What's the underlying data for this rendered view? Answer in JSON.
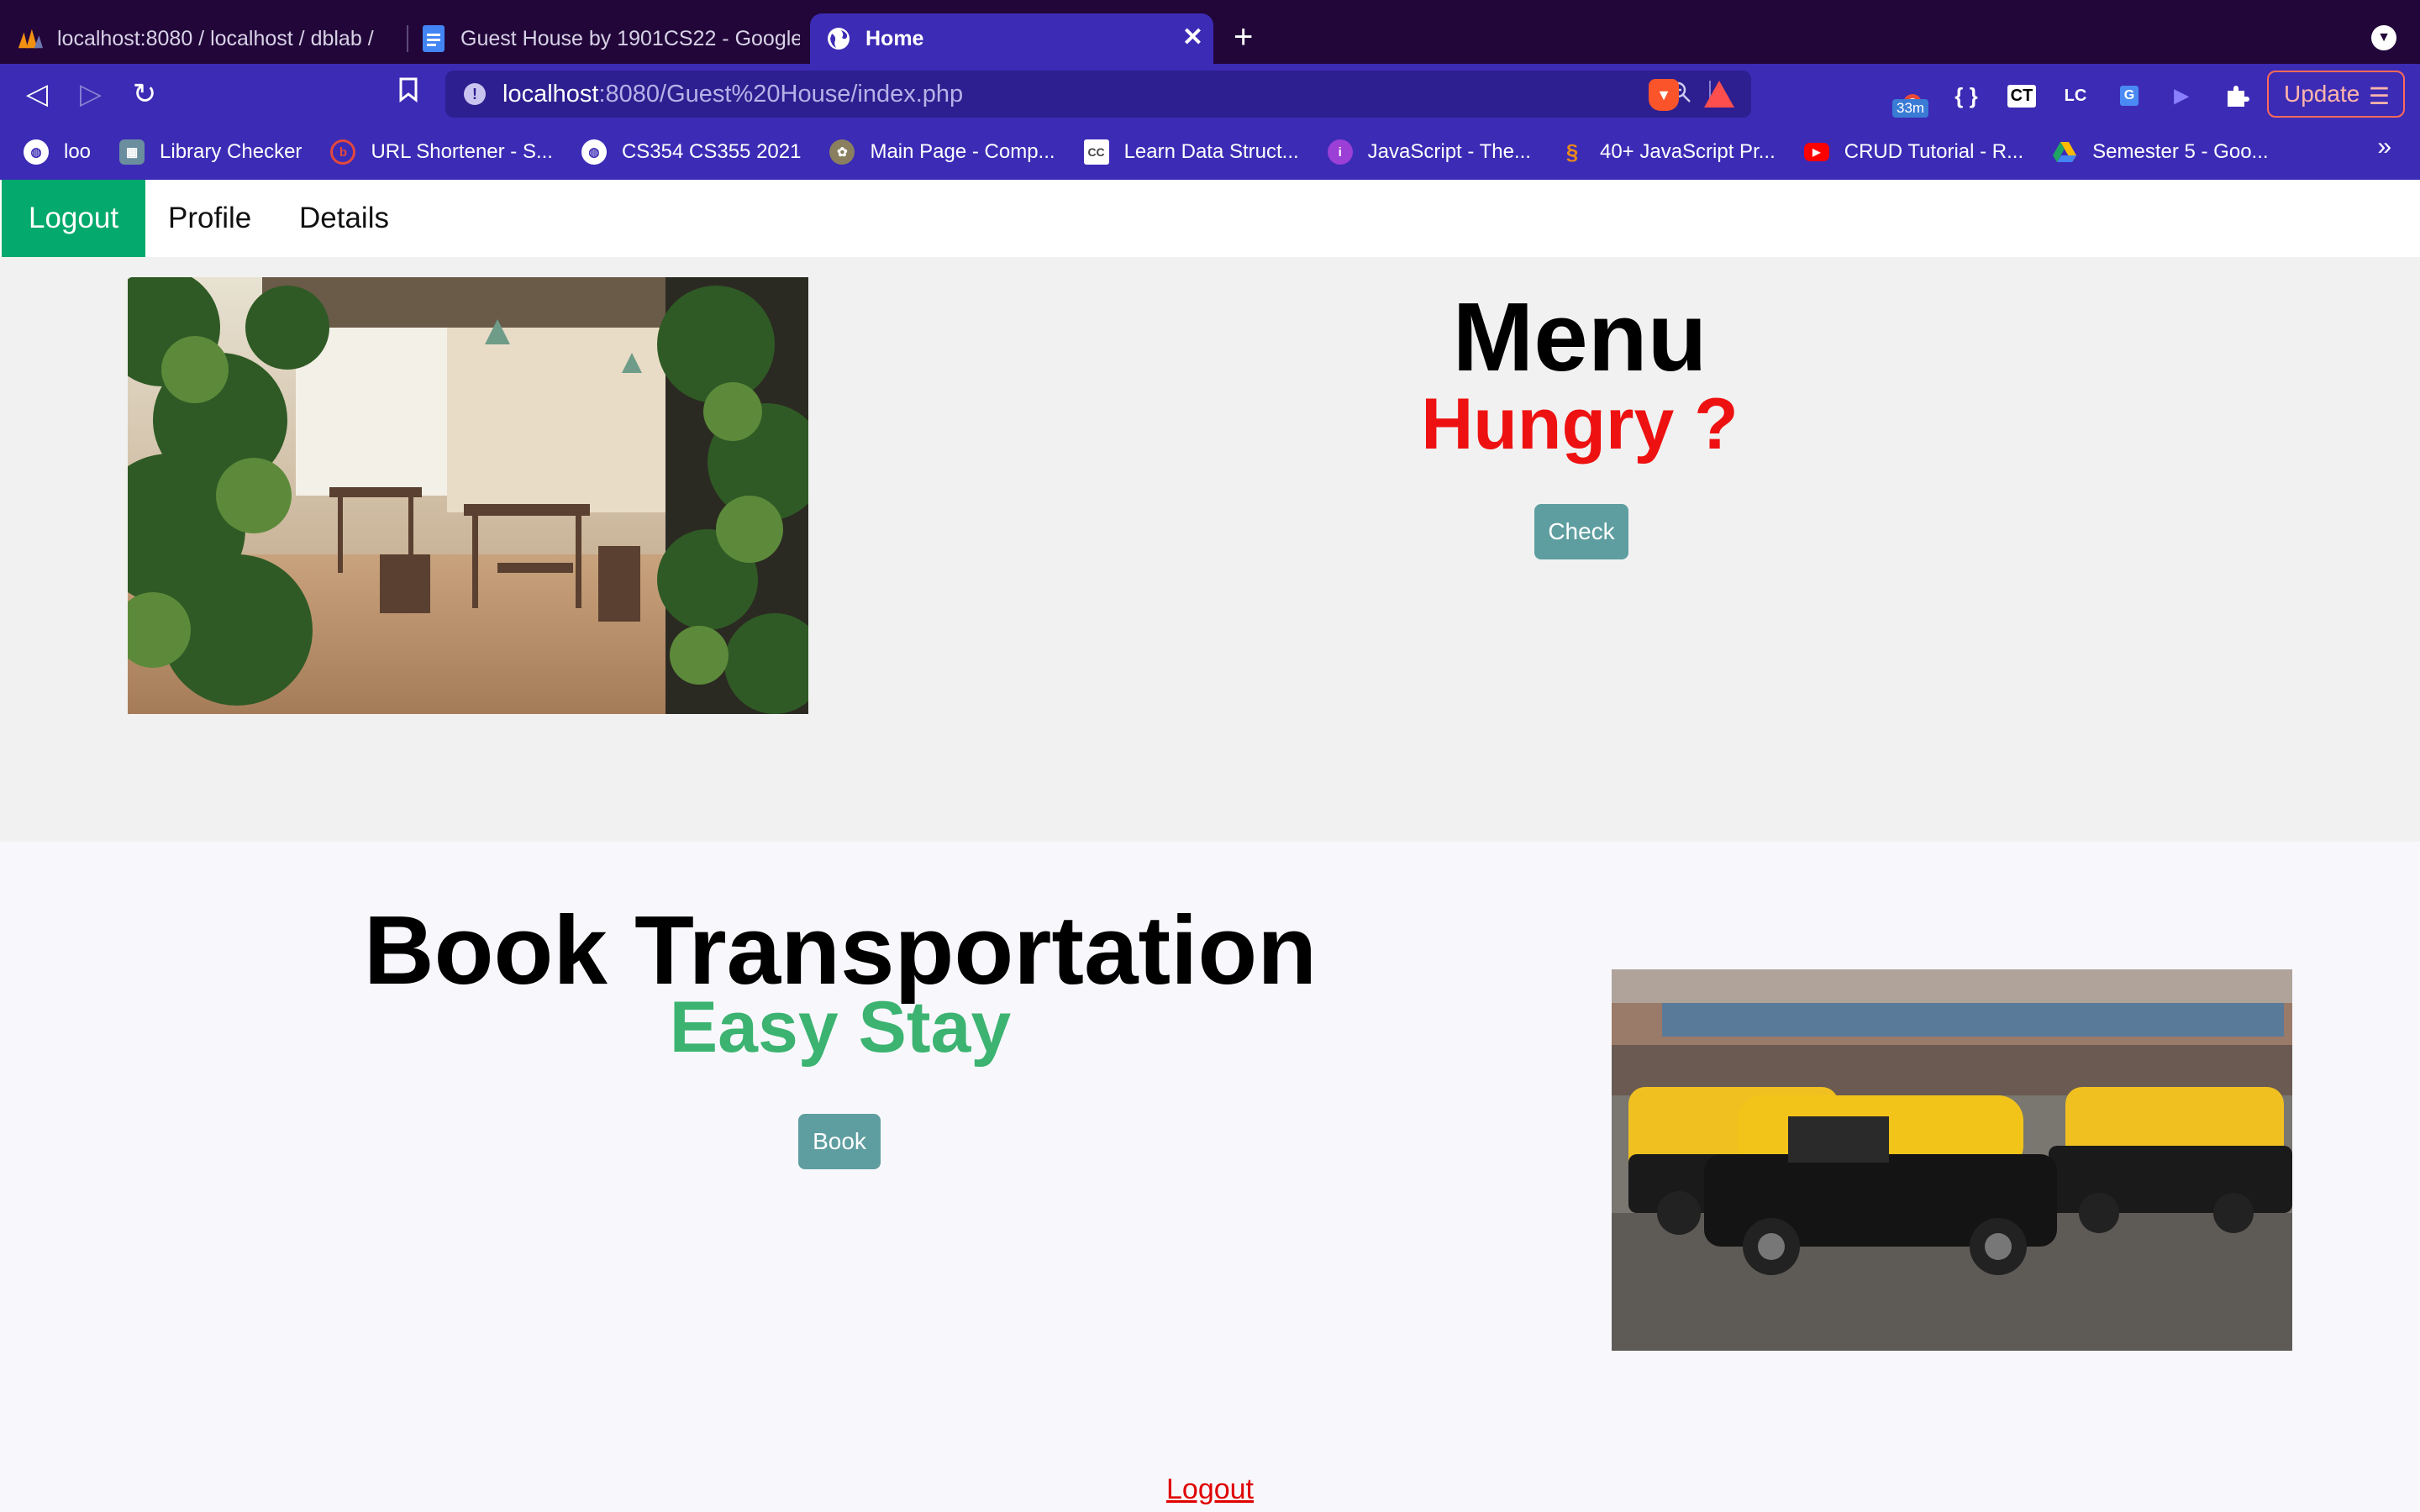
{
  "browser": {
    "tabs": [
      {
        "title": "localhost:8080 / localhost / dblab /",
        "icon": "phpmyadmin-icon"
      },
      {
        "title": "Guest House by 1901CS22 - Google",
        "icon": "google-docs-icon"
      },
      {
        "title": "Home",
        "icon": "globe-icon",
        "active": true
      }
    ],
    "url": {
      "host": "localhost",
      "path": ":8080/Guest%20House/index.php"
    },
    "extension_badge": "33m",
    "update_label": "Update",
    "bookmarks": [
      {
        "label": "loo",
        "icon": "globe-icon",
        "color": "#3c2bb5"
      },
      {
        "label": "Library Checker",
        "icon": "library-checker-icon",
        "color": "#6b8e9f"
      },
      {
        "label": "URL Shortener - S...",
        "icon": "url-shortener-icon",
        "color": "#e2483d"
      },
      {
        "label": "CS354 CS355 2021",
        "icon": "globe-icon",
        "color": "#3c2bb5"
      },
      {
        "label": "Main Page - Comp...",
        "icon": "wiki-icon",
        "color": "#8a7f5e"
      },
      {
        "label": "Learn Data Struct...",
        "icon": "cc-icon",
        "color": "#444444"
      },
      {
        "label": "JavaScript - The...",
        "icon": "javascript-info-icon",
        "color": "#9b3fd6"
      },
      {
        "label": "40+ JavaScript Pr...",
        "icon": "swirl-icon",
        "color": "#e8891d"
      },
      {
        "label": "CRUD Tutorial - R...",
        "icon": "youtube-icon",
        "color": "#ff0000"
      },
      {
        "label": "Semester 5 - Goo...",
        "icon": "google-drive-icon",
        "color": "#1fa463"
      }
    ]
  },
  "nav": {
    "logout": "Logout",
    "profile": "Profile",
    "details": "Details"
  },
  "menu_section": {
    "title": "Menu",
    "subtitle": "Hungry ?",
    "subtitle_color": "#ee1111",
    "button": "Check"
  },
  "transport_section": {
    "title": "Book Transportation",
    "subtitle": "Easy Stay",
    "subtitle_color": "#3cb371",
    "button": "Book"
  },
  "footer": {
    "logout": "Logout"
  }
}
